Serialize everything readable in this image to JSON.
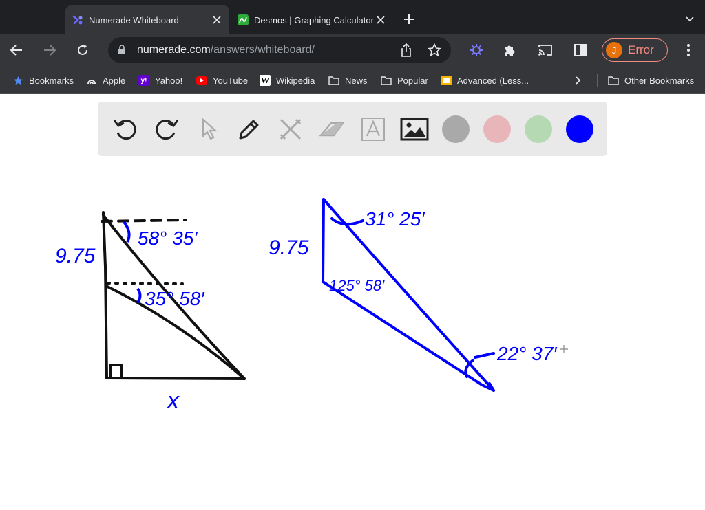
{
  "browser": {
    "tabs": [
      {
        "title": "Numerade Whiteboard",
        "active": true,
        "favicon": "numerade-logo-icon"
      },
      {
        "title": "Desmos | Graphing Calculator",
        "active": false,
        "favicon": "desmos-logo-icon"
      }
    ],
    "url_host": "numerade.com",
    "url_path": "/answers/whiteboard/",
    "profile_initial": "J",
    "profile_status": "Error"
  },
  "bookmarks": [
    {
      "label": "Bookmarks",
      "icon": "star-icon"
    },
    {
      "label": "Apple",
      "icon": "apple-icon"
    },
    {
      "label": "Yahoo!",
      "icon": "yahoo-icon"
    },
    {
      "label": "YouTube",
      "icon": "youtube-icon"
    },
    {
      "label": "Wikipedia",
      "icon": "wikipedia-icon"
    },
    {
      "label": "News",
      "icon": "folder-icon"
    },
    {
      "label": "Popular",
      "icon": "folder-icon"
    },
    {
      "label": "Advanced (Less...",
      "icon": "document-icon"
    }
  ],
  "other_bookmarks": "Other Bookmarks",
  "whiteboard": {
    "tools": [
      "undo",
      "redo",
      "select",
      "pen",
      "tools",
      "eraser",
      "text",
      "image"
    ],
    "colors": [
      "#a9a9a9",
      "#e8b5b9",
      "#b5d9b3",
      "#0000ff"
    ],
    "selected_color": "#0000ff"
  },
  "annotations": {
    "left_side": "9.75",
    "top_angle": "58° 35′",
    "mid_angle": "35° 58′",
    "bottom_label": "x",
    "right_side": "9.75",
    "apex_angle": "31° 25′",
    "obtuse_angle": "125° 58′",
    "small_angle": "22° 37′"
  }
}
